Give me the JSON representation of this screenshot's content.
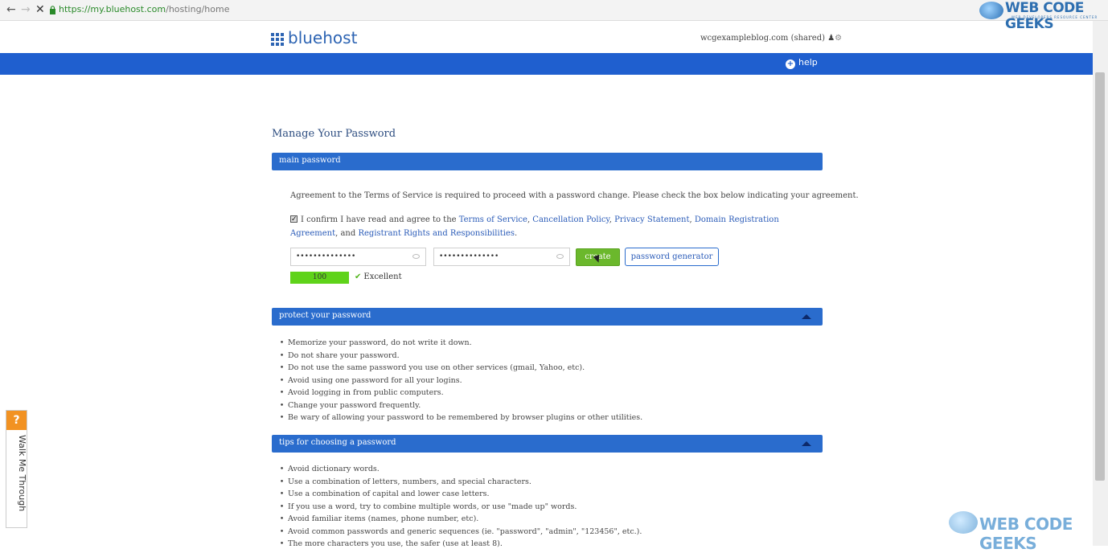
{
  "browser": {
    "url_host": "https://my.bluehost.com",
    "url_path": "/hosting/home"
  },
  "header": {
    "logo_text": "bluehost",
    "account": "wcgexampleblog.com (shared)",
    "help_label": "help"
  },
  "page_title": "Manage Your Password",
  "main_password": {
    "section_label": "main password",
    "agreement_text": "Agreement to the Terms of Service is required to proceed with a password change. Please check the box below indicating your agreement.",
    "confirm_prefix": "I confirm I have read and agree to the ",
    "links": {
      "tos": "Terms of Service",
      "cancellation": "Cancellation Policy",
      "privacy": "Privacy Statement",
      "domain": "Domain Registration Agreement",
      "registrant": "Registrant Rights and Responsibilities"
    },
    "confirm_and": ", and",
    "confirm_suffix": ".",
    "password_value": "••••••••••••••",
    "confirm_value": "••••••••••••••",
    "create_label": "create",
    "generator_label": "password generator",
    "strength_score": "100",
    "strength_label": "Excellent"
  },
  "protect": {
    "section_label": "protect your password",
    "items": [
      "Memorize your password, do not write it down.",
      "Do not share your password.",
      "Do not use the same password you use on other services (gmail, Yahoo, etc).",
      "Avoid using one password for all your logins.",
      "Avoid logging in from public computers.",
      "Change your password frequently.",
      "Be wary of allowing your password to be remembered by browser plugins or other utilities."
    ]
  },
  "tips": {
    "section_label": "tips for choosing a password",
    "items": [
      "Avoid dictionary words.",
      "Use a combination of letters, numbers, and special characters.",
      "Use a combination of capital and lower case letters.",
      "If you use a word, try to combine multiple words, or use \"made up\" words.",
      "Avoid familiar items (names, phone number, etc).",
      "Avoid common passwords and generic sequences (ie. \"password\", \"admin\", \"123456\", etc.).",
      "The more characters you use, the safer (use at least 8)."
    ]
  },
  "walkme": {
    "badge": "?",
    "label": "Walk Me Through"
  },
  "watermark": {
    "text": "WEB CODE GEEKS",
    "sub": "WEB DEVELOPERS RESOURCE CENTER"
  },
  "colors": {
    "brand_blue": "#1f5fcf",
    "section_blue": "#2a6ccd",
    "create_green": "#6bb82c",
    "strength_green": "#5fd31a",
    "walkme_orange": "#f29222"
  }
}
